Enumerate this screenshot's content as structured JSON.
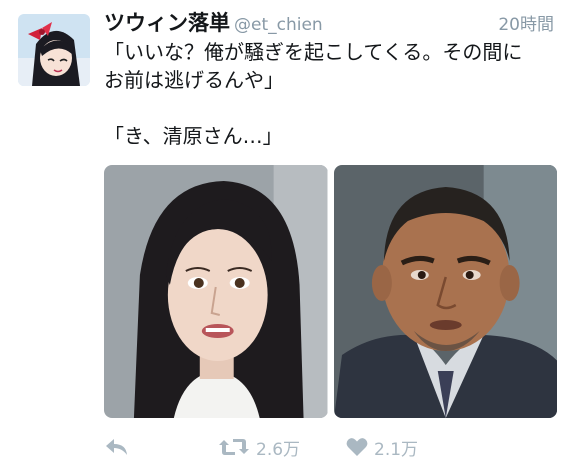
{
  "user": {
    "display_name": "ツウィン落単",
    "handle": "@et_chien",
    "timestamp": "20時間"
  },
  "tweet": {
    "lines": [
      "「いいな？俺が騒ぎを起こしてくる。その間に",
      "お前は逃げるんや」",
      "",
      "「き、清原さん…」"
    ]
  },
  "actions": {
    "reply_icon": "reply-icon",
    "retweet_icon": "retweet-icon",
    "retweet_count": "2.6万",
    "like_icon": "heart-icon",
    "like_count": "2.1万"
  },
  "colors": {
    "text": "#14171a",
    "muted": "#8899a6",
    "action": "#aab8c2"
  }
}
